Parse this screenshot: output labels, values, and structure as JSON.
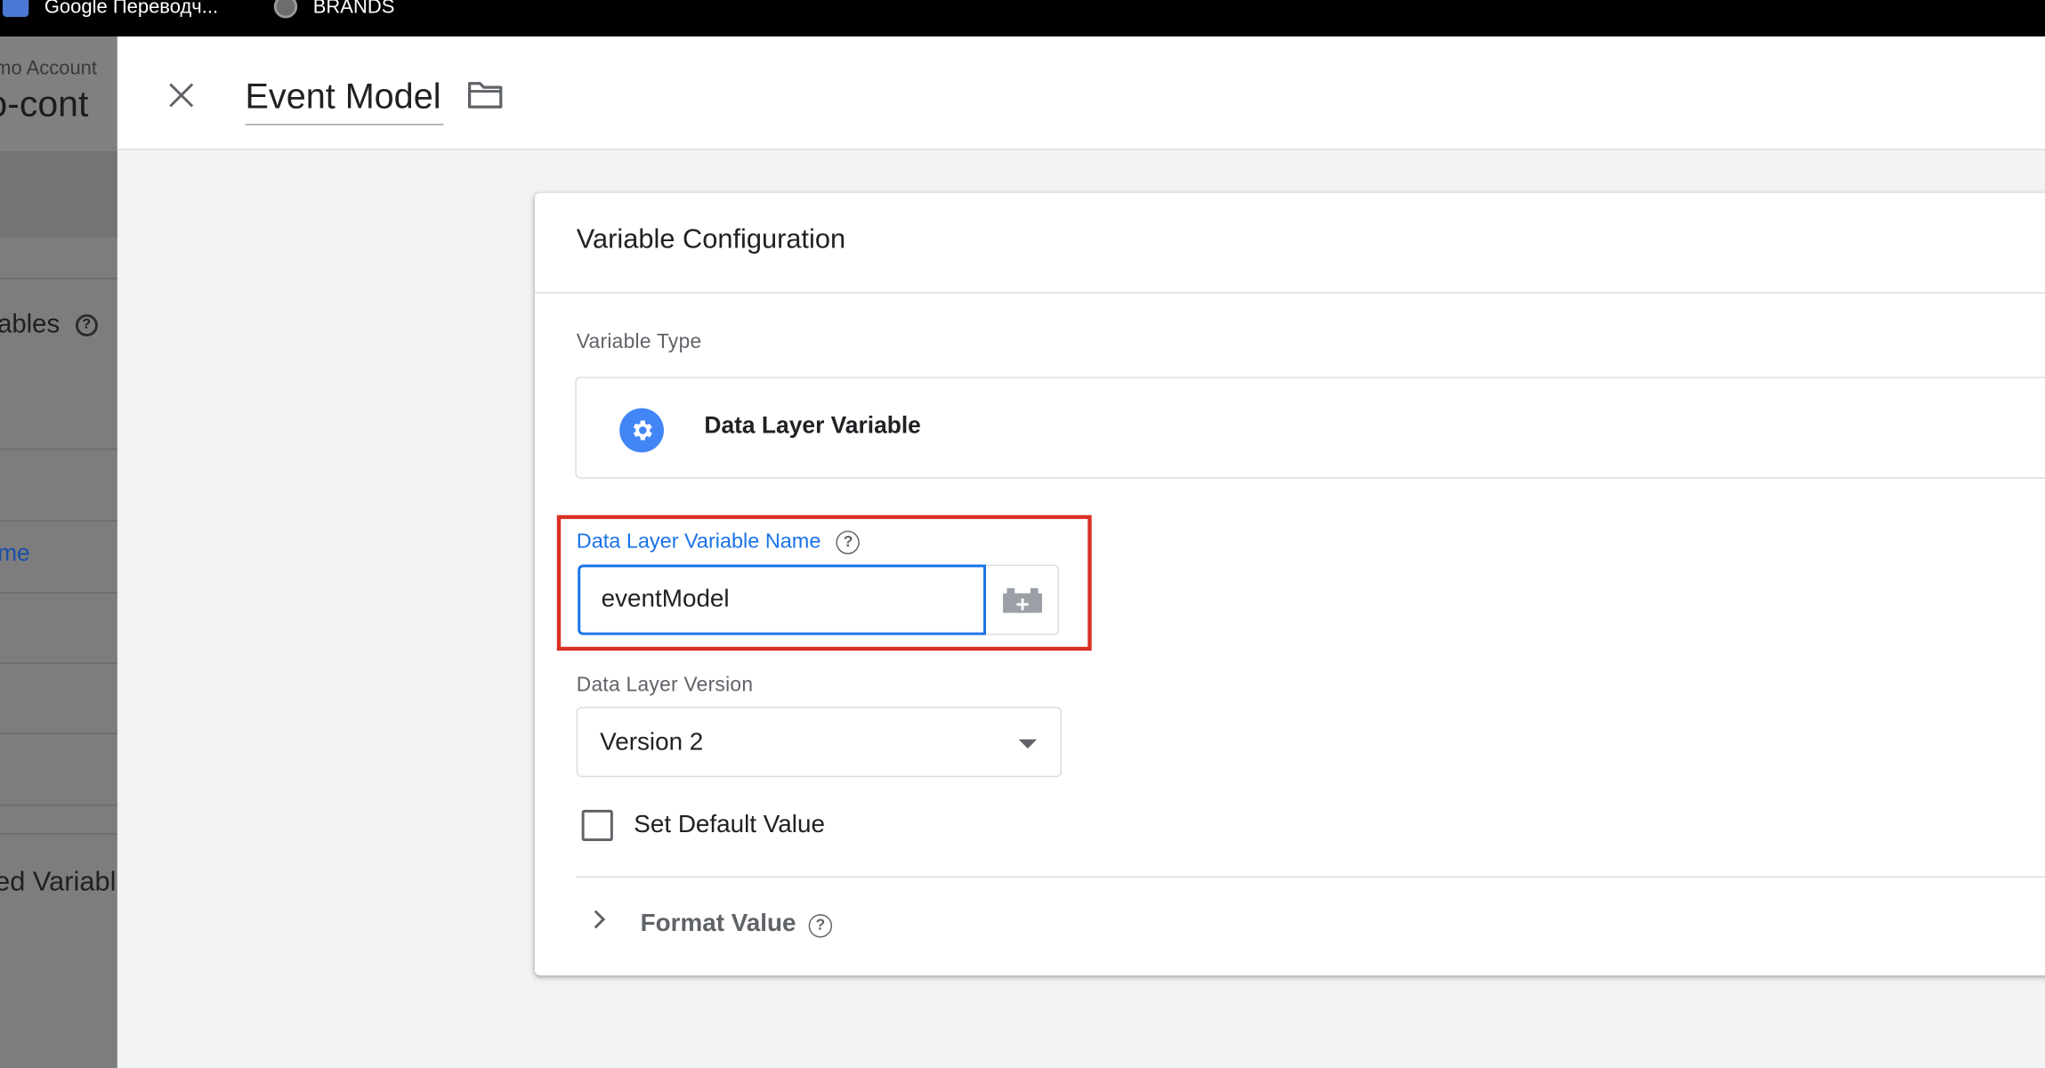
{
  "bookmarks": [
    {
      "label": "Google Переводч...",
      "icon": "translate-icon"
    },
    {
      "label": "BRANDS",
      "icon": "globe-icon"
    }
  ],
  "background_page": {
    "account": "mo Account",
    "container": "o-cont",
    "variables_heading": "ables",
    "link_text": "me",
    "user_defined_heading": "ed Variabl"
  },
  "panel": {
    "title": "Event Model",
    "close_icon": "close-icon",
    "folder_icon": "folder-icon"
  },
  "card": {
    "title": "Variable Configuration",
    "variable_type_label": "Variable Type",
    "variable_type_name": "Data Layer Variable",
    "variable_type_icon": "gear-icon",
    "dlv_name_label": "Data Layer Variable Name",
    "dlv_name_value": "eventModel",
    "version_label": "Data Layer Version",
    "version_value": "Version 2",
    "default_value_label": "Set Default Value",
    "default_value_checked": false,
    "format_value_label": "Format Value"
  },
  "colors": {
    "accent": "#1a73e8",
    "highlight": "#d93025",
    "gear_bg": "#4285f4"
  }
}
